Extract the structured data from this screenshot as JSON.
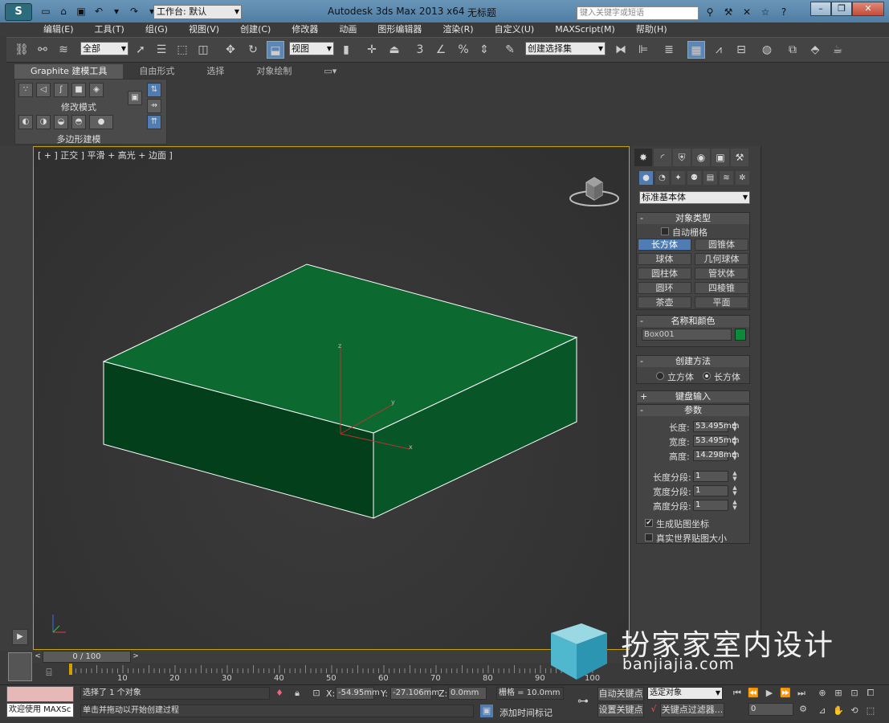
{
  "titlebar": {
    "workspace_label": "工作台: 默认",
    "app_title": "Autodesk 3ds Max  2013 x64",
    "doc_title": "无标题",
    "search_placeholder": "键入关键字或短语"
  },
  "menu": [
    "编辑(E)",
    "工具(T)",
    "组(G)",
    "视图(V)",
    "创建(C)",
    "修改器",
    "动画",
    "图形编辑器",
    "渲染(R)",
    "自定义(U)",
    "MAXScript(M)",
    "帮助(H)"
  ],
  "toolbar": {
    "selection_filter": "全部",
    "ref_coord": "视图",
    "named_selection": "创建选择集",
    "snap_labels": [
      "3",
      "%"
    ]
  },
  "ribbon": {
    "tabs": [
      "Graphite 建模工具",
      "自由形式",
      "选择",
      "对象绘制"
    ],
    "group_label": "修改模式",
    "footer_label": "多边形建模"
  },
  "viewport": {
    "label": "[ + ] 正交 ] 平滑 + 高光 + 边面 ]",
    "box_color": "#0a6a2e",
    "gizmo": {
      "x": "x",
      "y": "y",
      "z": "z"
    }
  },
  "command_panel": {
    "category": "标准基本体",
    "object_type": {
      "title": "对象类型",
      "autogrid": "自动栅格",
      "buttons": [
        "长方体",
        "圆锥体",
        "球体",
        "几何球体",
        "圆柱体",
        "管状体",
        "圆环",
        "四棱锥",
        "茶壶",
        "平面"
      ],
      "active": "长方体"
    },
    "name_color": {
      "title": "名称和颜色",
      "name": "Box001",
      "color": "#0b8a3c"
    },
    "creation_method": {
      "title": "创建方法",
      "options": [
        "立方体",
        "长方体"
      ],
      "selected": "长方体"
    },
    "keyboard_entry": {
      "title": "键盘输入"
    },
    "parameters": {
      "title": "参数",
      "length_label": "长度:",
      "length": "53.495mm",
      "width_label": "宽度:",
      "width": "53.495mm",
      "height_label": "高度:",
      "height": "14.298mm",
      "lseg_label": "长度分段:",
      "lseg": "1",
      "wseg_label": "宽度分段:",
      "wseg": "1",
      "hseg_label": "高度分段:",
      "hseg": "1",
      "gen_map": "生成贴图坐标",
      "real_world": "真实世界贴图大小"
    }
  },
  "timeline": {
    "frame": "0 / 100",
    "ticks": [
      "10",
      "20",
      "30",
      "40",
      "50",
      "60",
      "70",
      "80",
      "90",
      "100"
    ]
  },
  "status": {
    "maxscript": "欢迎使用 MAXSc",
    "selected": "选择了 1 个对象",
    "prompt": "单击并拖动以开始创建过程",
    "x_label": "X:",
    "x": "-54.95mm",
    "y_label": "Y:",
    "y": "-27.106mm",
    "z_label": "Z:",
    "z": "0.0mm",
    "grid": "栅格 = 10.0mm",
    "add_time_tag": "添加时间标记",
    "auto_key": "自动关键点",
    "set_key": "设置关键点",
    "key_mode": "选定对象",
    "key_filters": "关键点过滤器...",
    "frame_field": "0"
  },
  "watermark": {
    "title": "扮家家室内设计",
    "url": "banjiajia.com"
  }
}
